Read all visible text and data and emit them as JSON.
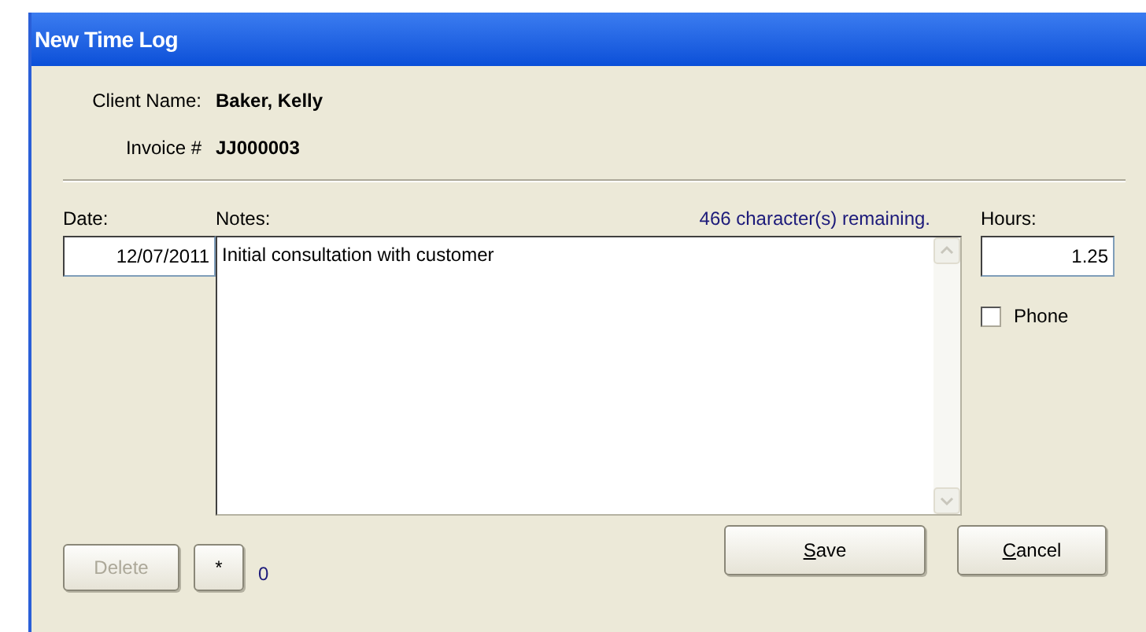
{
  "window": {
    "title": "New Time Log"
  },
  "client": {
    "label": "Client Name:",
    "value": "Baker, Kelly"
  },
  "invoice": {
    "label": "Invoice #",
    "value": "JJ000003"
  },
  "date": {
    "label": "Date:",
    "value": "12/07/2011"
  },
  "notes": {
    "label": "Notes:",
    "remaining": "466 character(s) remaining.",
    "value": "Initial consultation with customer"
  },
  "hours": {
    "label": "Hours:",
    "value": "1.25"
  },
  "phone": {
    "label": "Phone",
    "checked": false
  },
  "left_buttons": [
    {
      "label": "Delete",
      "disabled": true
    },
    {
      "label": "*",
      "disabled": false
    }
  ],
  "count": "0",
  "buttons": [
    {
      "label": "Save"
    },
    {
      "label": "Cancel"
    }
  ]
}
